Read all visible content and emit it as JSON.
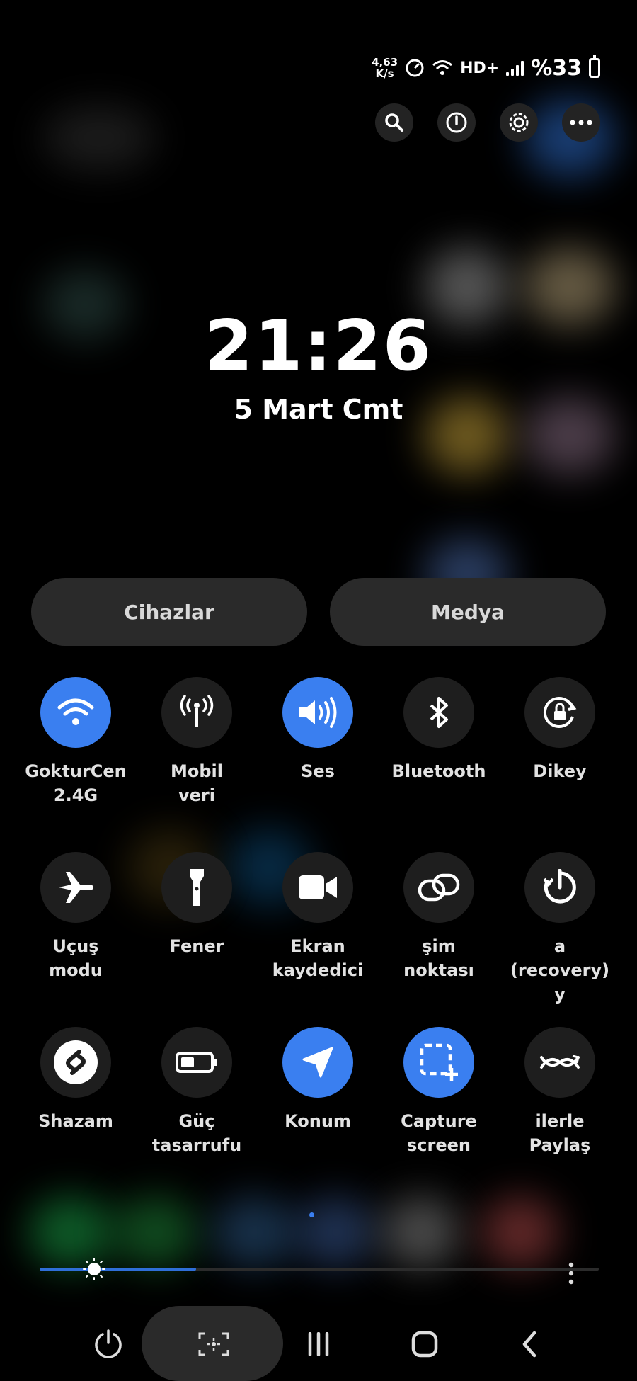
{
  "status": {
    "speed_value": "4,63",
    "speed_unit": "K/s",
    "network": "HD+",
    "battery": "%33"
  },
  "clock": {
    "time": "21:26",
    "date": "5 Mart Cmt"
  },
  "tabs": {
    "devices": "Cihazlar",
    "media": "Medya"
  },
  "tiles": [
    {
      "label": "GokturCen\n2.4G",
      "icon": "wifi-icon",
      "active": true
    },
    {
      "label": "Mobil\nveri",
      "icon": "mobile-data-icon",
      "active": false
    },
    {
      "label": "Ses",
      "icon": "sound-icon",
      "active": true
    },
    {
      "label": "Bluetooth",
      "icon": "bluetooth-icon",
      "active": false
    },
    {
      "label": "Dikey",
      "icon": "rotation-lock-icon",
      "active": false
    },
    {
      "label": "Uçuş\nmodu",
      "icon": "airplane-icon",
      "active": false
    },
    {
      "label": "Fener",
      "icon": "flashlight-icon",
      "active": false
    },
    {
      "label": "Ekran\nkaydedici",
      "icon": "screen-recorder-icon",
      "active": false
    },
    {
      "label": "şim noktası",
      "icon": "hotspot-icon",
      "active": false
    },
    {
      "label": "a (recovery) y",
      "icon": "recovery-icon",
      "active": false
    },
    {
      "label": "Shazam",
      "icon": "shazam-icon",
      "active": false
    },
    {
      "label": "Güç\ntasarrufu",
      "icon": "battery-saver-icon",
      "active": false
    },
    {
      "label": "Konum",
      "icon": "location-icon",
      "active": true
    },
    {
      "label": "Capture\nscreen",
      "icon": "capture-screen-icon",
      "active": true
    },
    {
      "label": "ilerle Paylaş",
      "icon": "share-icon",
      "active": false
    }
  ],
  "brightness": {
    "level": 0.28
  },
  "colors": {
    "accent": "#3a7ff0",
    "tile_off": "#1e1e1e",
    "pill": "#2a2a2a"
  }
}
